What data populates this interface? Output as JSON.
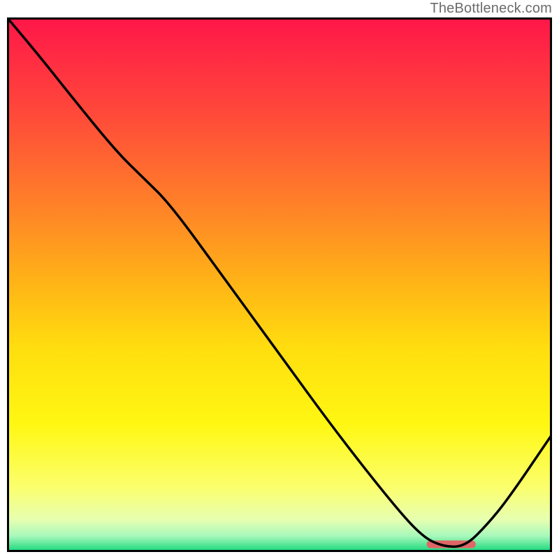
{
  "attribution": "TheBottleneck.com",
  "chart_data": {
    "type": "line",
    "title": "",
    "xlabel": "",
    "ylabel": "",
    "xlim": [
      0,
      100
    ],
    "ylim": [
      0,
      100
    ],
    "grid": false,
    "series": [
      {
        "name": "curve",
        "color": "#000000",
        "x": [
          0,
          5,
          12,
          20,
          25,
          30,
          40,
          50,
          60,
          70,
          76,
          80,
          84,
          88,
          92,
          100
        ],
        "values": [
          100,
          94,
          85,
          75,
          70,
          65,
          51,
          37,
          23,
          10,
          3,
          1,
          1,
          5,
          10,
          22
        ]
      }
    ],
    "marker": {
      "name": "optimum-marker",
      "x_start": 77,
      "x_end": 86,
      "y": 1.5,
      "color": "#e06666"
    },
    "background_gradient": {
      "stops": [
        {
          "y": 100,
          "color": "#ff1649"
        },
        {
          "y": 82,
          "color": "#ff493a"
        },
        {
          "y": 64,
          "color": "#ff8427"
        },
        {
          "y": 50,
          "color": "#ffb516"
        },
        {
          "y": 38,
          "color": "#ffde0f"
        },
        {
          "y": 24,
          "color": "#fff712"
        },
        {
          "y": 12,
          "color": "#fbff6e"
        },
        {
          "y": 6,
          "color": "#e6ffb1"
        },
        {
          "y": 3,
          "color": "#a7f8bb"
        },
        {
          "y": 0,
          "color": "#12d77a"
        }
      ]
    },
    "frame_color": "#000000"
  }
}
